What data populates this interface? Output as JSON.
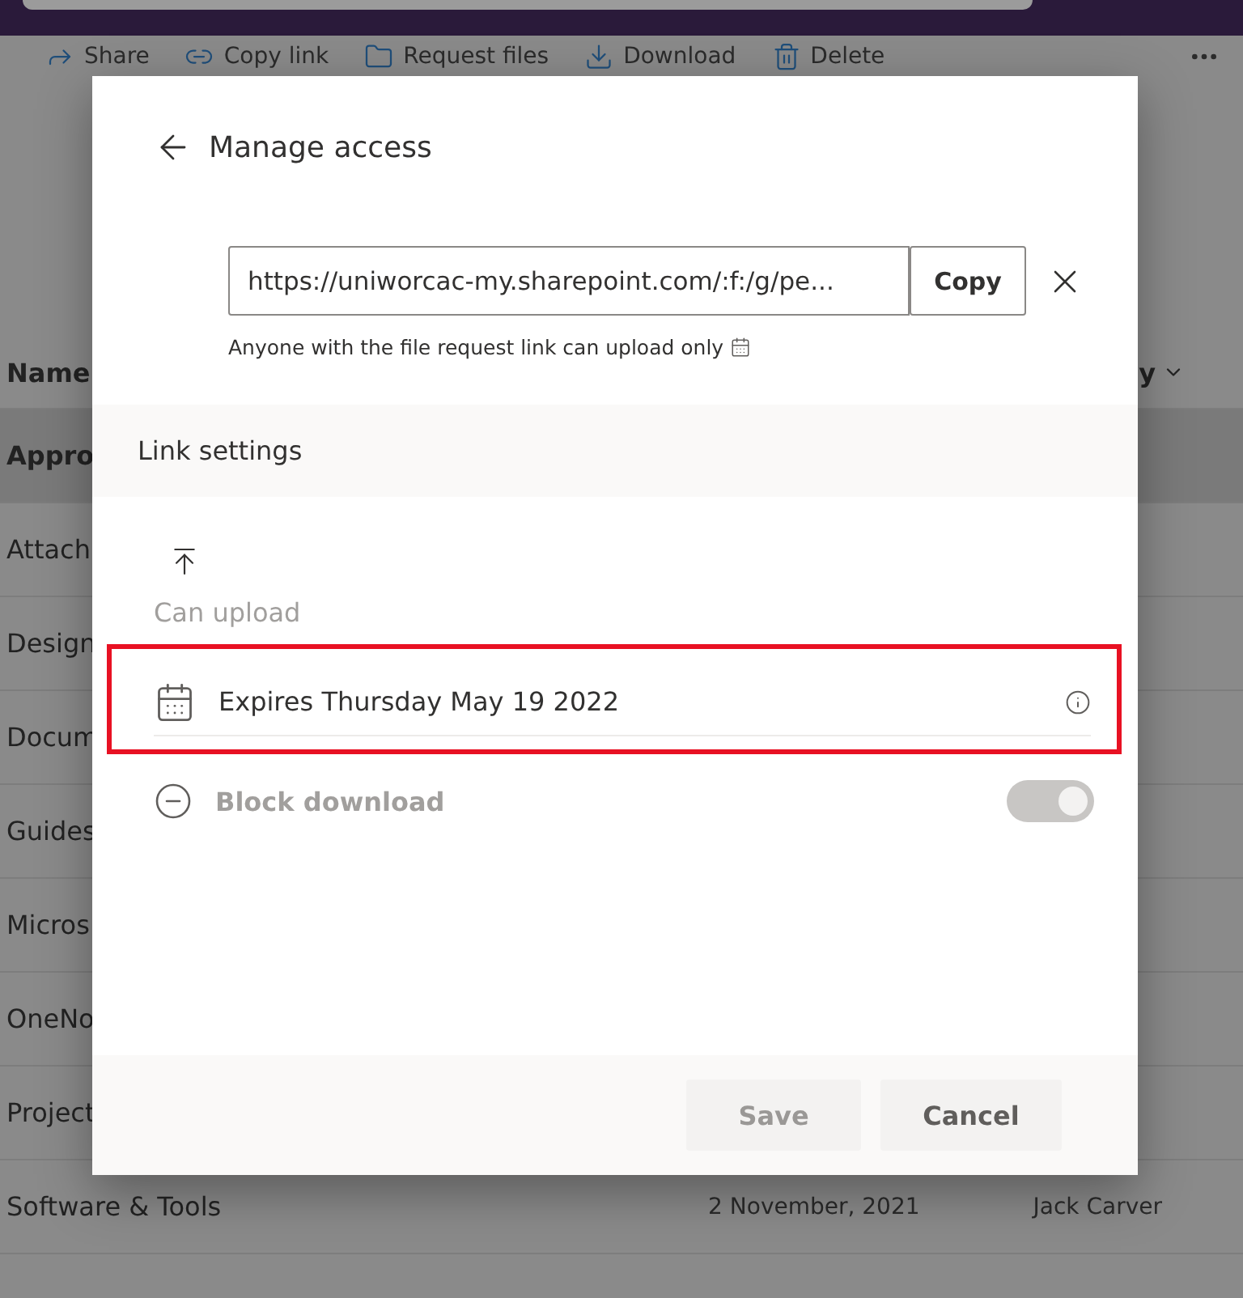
{
  "toolbar": {
    "items": [
      {
        "label": "Share"
      },
      {
        "label": "Copy link"
      },
      {
        "label": "Request files"
      },
      {
        "label": "Download"
      },
      {
        "label": "Delete"
      }
    ]
  },
  "file_list": {
    "columns": [
      {
        "label": "Name"
      },
      {
        "label": "y"
      }
    ],
    "rows": [
      {
        "name": "Appro",
        "selected": true
      },
      {
        "name": "Attach",
        "selected": false
      },
      {
        "name": "Design",
        "selected": false
      },
      {
        "name": "Docum",
        "selected": false
      },
      {
        "name": "Guides",
        "selected": false
      },
      {
        "name": "Micros",
        "selected": false
      },
      {
        "name": "OneNo",
        "selected": false
      },
      {
        "name": "Project",
        "selected": false
      },
      {
        "name": "Software & Tools",
        "selected": false,
        "modified": "2 November, 2021",
        "modified_by": "Jack Carver"
      }
    ]
  },
  "dialog": {
    "title": "Manage access",
    "link": {
      "value": "https://uniworcac-my.sharepoint.com/:f:/g/pe...",
      "button": "Copy"
    },
    "caption": "Anyone with the file request link can upload only",
    "section_title": "Link settings",
    "permission": "Can upload",
    "settings": [
      {
        "kind": "expiry",
        "label": "Expires",
        "value": "Thursday May 19 2022",
        "highlighted": true
      },
      {
        "kind": "toggle",
        "label": "Block download",
        "on": true,
        "disabled": true
      }
    ],
    "buttons": [
      {
        "label": "Save",
        "disabled": true
      },
      {
        "label": "Cancel",
        "disabled": false
      }
    ]
  }
}
